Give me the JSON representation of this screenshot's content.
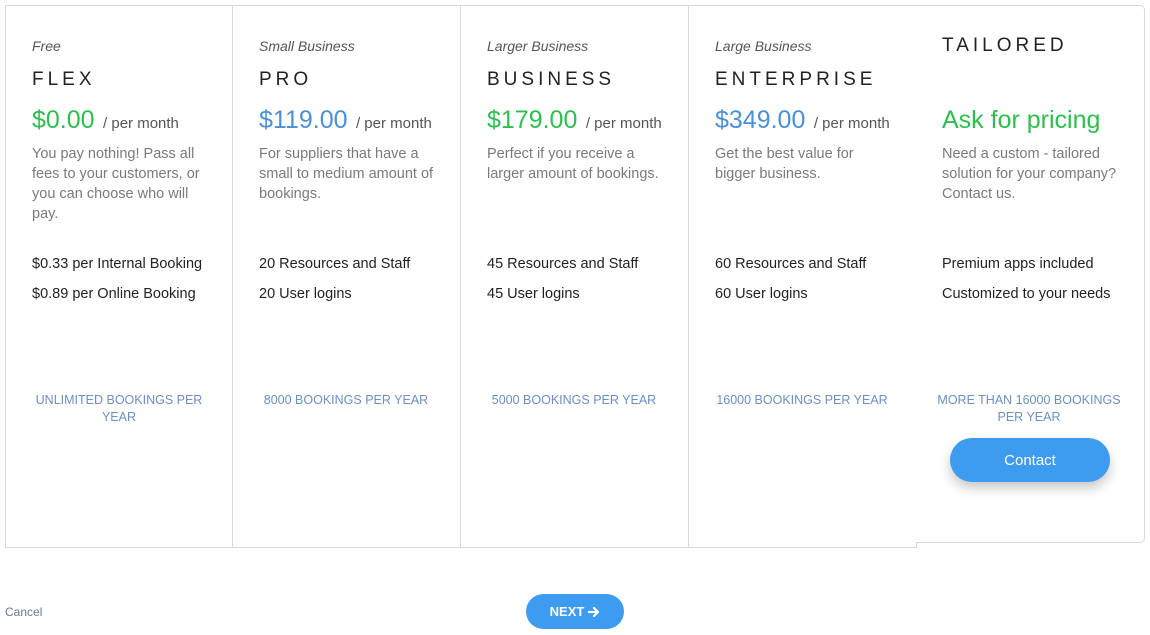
{
  "plans": [
    {
      "tier": "Free",
      "name": "FLEX",
      "price": "$0.00",
      "per": "/ per month",
      "description": "You pay nothing! Pass all fees to your customers, or you can choose who will pay.",
      "features": [
        "$0.33 per Internal Booking",
        "$0.89 per Online Booking"
      ],
      "bookings": "UNLIMITED BOOKINGS PER YEAR",
      "price_color": "#2dbe4e"
    },
    {
      "tier": "Small Business",
      "name": "PRO",
      "price": "$119.00",
      "per": "/ per month",
      "description": "For suppliers that have a small to medium amount of bookings.",
      "features": [
        "20 Resources and Staff",
        "20 User logins"
      ],
      "bookings": "8000 BOOKINGS PER YEAR",
      "price_color": "#4a90d9"
    },
    {
      "tier": "Larger Business",
      "name": "BUSINESS",
      "price": "$179.00",
      "per": "/ per month",
      "description": "Perfect if you receive a larger amount of bookings.",
      "features": [
        "45 Resources and Staff",
        "45 User logins"
      ],
      "bookings": "5000 BOOKINGS PER YEAR",
      "price_color": "#2dbe4e"
    },
    {
      "tier": "Large Business",
      "name": "ENTERPRISE",
      "price": "$349.00",
      "per": "/ per month",
      "description": "Get the best value for bigger business.",
      "features": [
        "60 Resources and Staff",
        "60 User logins"
      ],
      "bookings": "16000 BOOKINGS PER YEAR",
      "price_color": "#4a90d9"
    },
    {
      "name": "TAILORED",
      "price": "Ask for pricing",
      "description": "Need a custom - tailored solution for your company? Contact us.",
      "features": [
        "Premium apps included",
        "Customized to your needs"
      ],
      "bookings": "MORE THAN 16000 BOOKINGS PER YEAR",
      "button": "Contact",
      "price_color": "#2dbe4e"
    }
  ],
  "footer": {
    "cancel": "Cancel",
    "next": "NEXT",
    "next_icon": "arrow-right-icon"
  }
}
